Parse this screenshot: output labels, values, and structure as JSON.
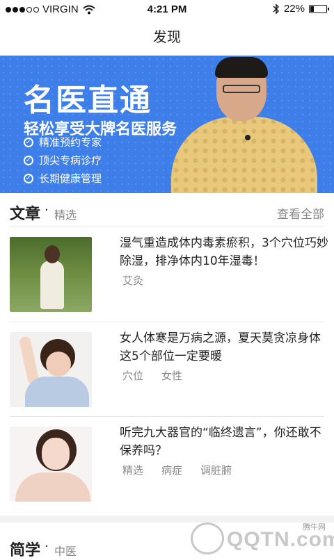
{
  "status_bar": {
    "carrier": "VIRGIN",
    "time": "4:21 PM",
    "battery": "22%",
    "battery_level": 0.22,
    "signal_bars_filled": 3,
    "signal_bars_total": 5,
    "icons": [
      "wifi-icon",
      "bluetooth-icon",
      "battery-icon"
    ]
  },
  "nav": {
    "title": "发现"
  },
  "banner": {
    "title": "名医直通",
    "subtitle": "轻松享受大牌名医服务",
    "features": [
      "精准预约专家",
      "顶尖专病诊疗",
      "长期健康管理"
    ],
    "accent": "#3d7ee8"
  },
  "articles_section": {
    "heading": "文章",
    "sub": "精选",
    "view_all": "查看全部",
    "items": [
      {
        "title": "湿气重造成体内毒素瘀积，3个穴位巧妙除湿，排净体内10年湿毒！",
        "tags": [
          "艾灸"
        ]
      },
      {
        "title": "女人体寒是万病之源，夏天莫贪凉身体这5个部位一定要暖",
        "tags": [
          "穴位",
          "女性"
        ]
      },
      {
        "title": "听完九大器官的“临终遗言”，你还敢不保养吗？",
        "tags": [
          "精选",
          "病症",
          "调脏腑"
        ]
      }
    ]
  },
  "next_section": {
    "heading": "简学",
    "sub": "中医"
  },
  "watermark": {
    "text": "QQTN.com",
    "small": "腾牛网"
  }
}
